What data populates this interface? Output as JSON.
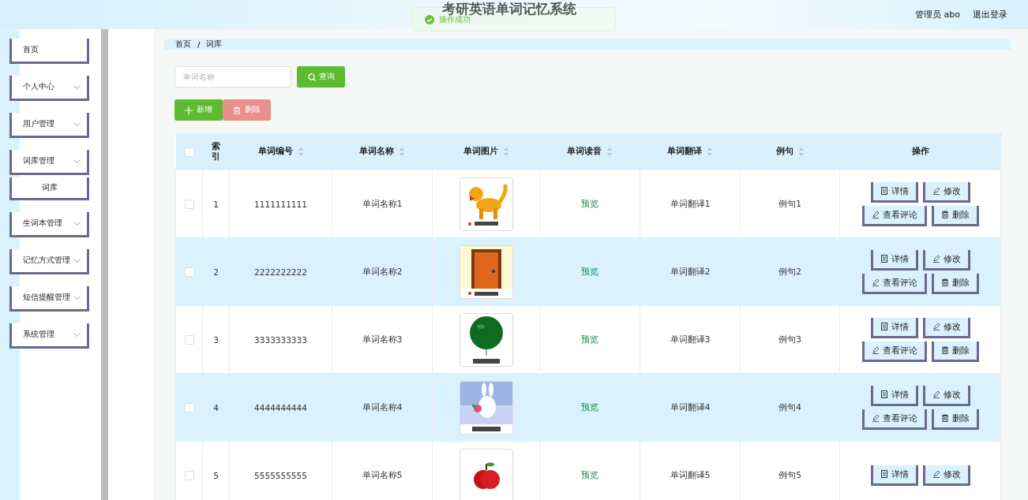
{
  "header": {
    "title": "考研英语单词记忆系统",
    "user": "管理员 abo",
    "logout": "退出登录"
  },
  "toast": {
    "message": "操作成功"
  },
  "sidebar": {
    "items": [
      {
        "label": "首页",
        "expandable": false
      },
      {
        "label": "个人中心",
        "expandable": true
      },
      {
        "label": "用户管理",
        "expandable": true
      },
      {
        "label": "词库管理",
        "expandable": true,
        "children": [
          {
            "label": "词库"
          }
        ]
      },
      {
        "label": "生词本管理",
        "expandable": true
      },
      {
        "label": "记忆方式管理",
        "expandable": true
      },
      {
        "label": "短信提醒管理",
        "expandable": true
      },
      {
        "label": "系统管理",
        "expandable": true
      }
    ]
  },
  "breadcrumb": {
    "separator": "/",
    "items": [
      "首页",
      "词库"
    ]
  },
  "search": {
    "placeholder": "单词名称",
    "button": "查询"
  },
  "actions": [
    {
      "label": "新增",
      "kind": "add",
      "disabled": false
    },
    {
      "label": "删除",
      "kind": "delete",
      "disabled": true
    }
  ],
  "table": {
    "select_all_checked": false,
    "columns": [
      {
        "label": "索引",
        "sortable": false
      },
      {
        "label": "单词编号",
        "sortable": true
      },
      {
        "label": "单词名称",
        "sortable": true
      },
      {
        "label": "单词图片",
        "sortable": true
      },
      {
        "label": "单词读音",
        "sortable": true
      },
      {
        "label": "单词翻译",
        "sortable": true
      },
      {
        "label": "例句",
        "sortable": true
      },
      {
        "label": "操作",
        "sortable": false
      }
    ],
    "rows": [
      {
        "checked": false,
        "index": "1",
        "code": "1111111111",
        "name": "单词名称1",
        "image": {
          "kind": "picture"
        },
        "audio": "预览",
        "translation": "单词翻译1",
        "example": "例句1",
        "buttons": [
          {
            "label": "详情",
            "kind": "detail"
          },
          {
            "label": "修改",
            "kind": "edit"
          },
          {
            "label": "查看评论",
            "kind": "comment"
          },
          {
            "label": "删除",
            "kind": "delete"
          }
        ]
      },
      {
        "checked": false,
        "index": "2",
        "code": "2222222222",
        "name": "单词名称2",
        "image": {
          "kind": "picture"
        },
        "audio": "预览",
        "translation": "单词翻译2",
        "example": "例句2",
        "buttons": [
          {
            "label": "详情",
            "kind": "detail"
          },
          {
            "label": "修改",
            "kind": "edit"
          },
          {
            "label": "查看评论",
            "kind": "comment"
          },
          {
            "label": "删除",
            "kind": "delete"
          }
        ]
      },
      {
        "checked": false,
        "index": "3",
        "code": "3333333333",
        "name": "单词名称3",
        "image": {
          "kind": "picture"
        },
        "audio": "预览",
        "translation": "单词翻译3",
        "example": "例句3",
        "buttons": [
          {
            "label": "详情",
            "kind": "detail"
          },
          {
            "label": "修改",
            "kind": "edit"
          },
          {
            "label": "查看评论",
            "kind": "comment"
          },
          {
            "label": "删除",
            "kind": "delete"
          }
        ]
      },
      {
        "checked": false,
        "index": "4",
        "code": "4444444444",
        "name": "单词名称4",
        "image": {
          "kind": "picture"
        },
        "audio": "预览",
        "translation": "单词翻译4",
        "example": "例句4",
        "buttons": [
          {
            "label": "详情",
            "kind": "detail"
          },
          {
            "label": "修改",
            "kind": "edit"
          },
          {
            "label": "查看评论",
            "kind": "comment"
          },
          {
            "label": "删除",
            "kind": "delete"
          }
        ]
      },
      {
        "checked": false,
        "index": "5",
        "code": "5555555555",
        "name": "单词名称5",
        "image": {
          "kind": "picture"
        },
        "audio": "预览",
        "translation": "单词翻译5",
        "example": "例句5",
        "buttons": [
          {
            "label": "详情",
            "kind": "detail"
          },
          {
            "label": "修改",
            "kind": "edit"
          }
        ]
      }
    ]
  }
}
